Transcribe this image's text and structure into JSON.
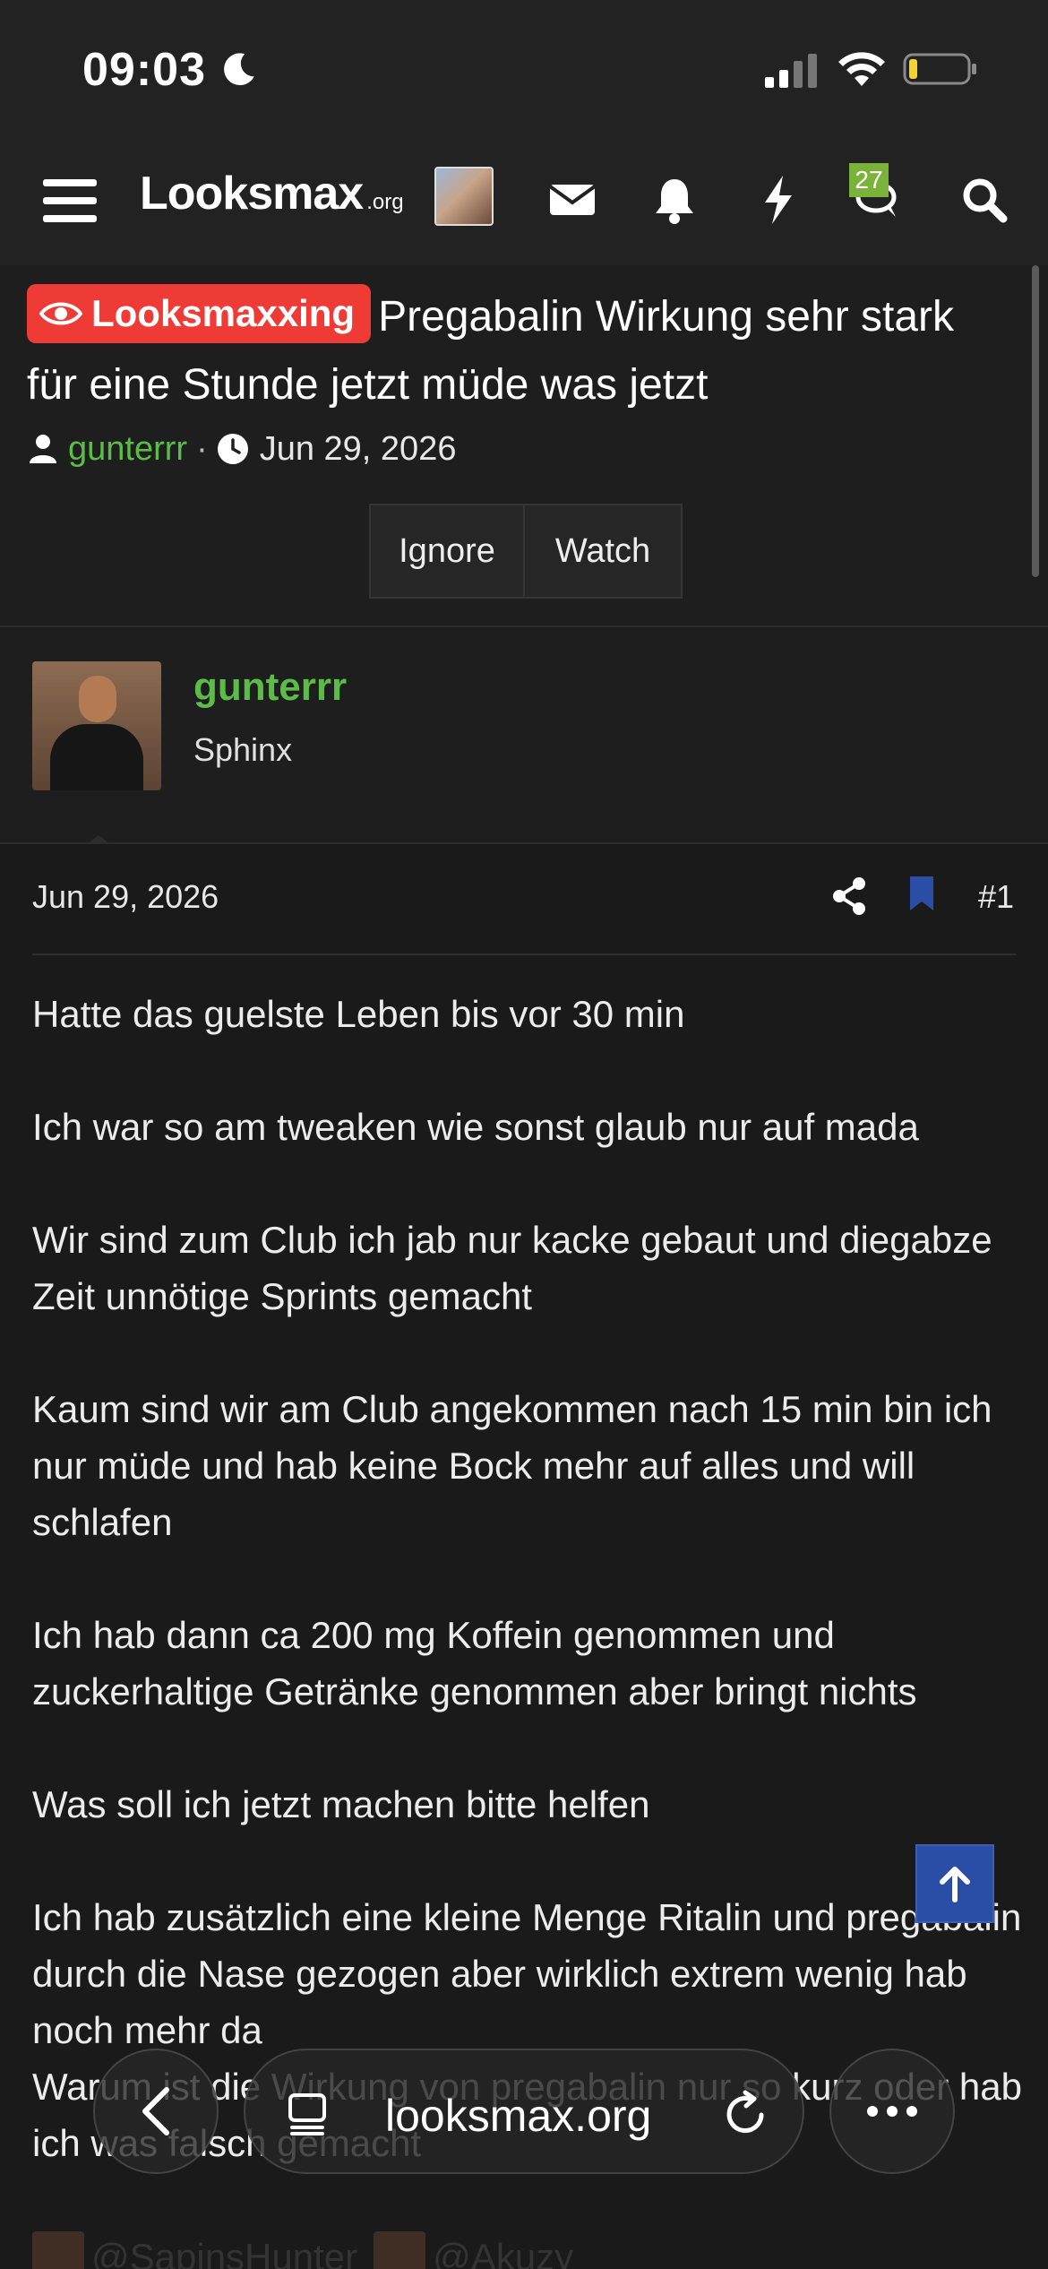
{
  "status_bar": {
    "time": "09:03"
  },
  "nav": {
    "logo_main": "Looksmax",
    "logo_suffix": ".org",
    "conversations_badge": "27"
  },
  "thread": {
    "prefix": "Looksmaxxing",
    "title": "Pregabalin Wirkung sehr stark für eine Stunde jetzt müde was jetzt",
    "author": "gunterrr",
    "date": "Jun 29, 2026",
    "ignore_label": "Ignore",
    "watch_label": "Watch"
  },
  "author_box": {
    "name": "gunterrr",
    "user_title": "Sphinx"
  },
  "post": {
    "date": "Jun 29, 2026",
    "number": "#1",
    "paragraphs": [
      "Hatte das guelste Leben bis vor 30 min",
      "Ich war so am tweaken wie sonst glaub nur auf mada",
      "Wir sind zum Club ich jab nur kacke gebaut und diegabze Zeit unnötige Sprints gemacht",
      "Kaum sind wir am Club angekommen nach 15 min bin ich nur müde und hab keine Bock mehr auf alles und will schlafen",
      "Ich hab dann ca 200 mg Koffein genommen und zuckerhaltige Getränke genommen aber bringt nichts",
      "Was soll ich jetzt machen bitte helfen",
      "Ich hab zusätzlich eine kleine Menge Ritalin und pregabalin durch die Nase gezogen aber wirklich extrem wenig hab noch mehr da",
      "Warum ist die Wirkung von pregabalin nur so kurz oder hab ich was falsch gemacht"
    ],
    "mentions": [
      "@SapinsHunter",
      "@Akuzy"
    ]
  },
  "browser": {
    "url": "looksmax.org"
  },
  "colors": {
    "accent_green": "#5bbd48",
    "prefix_red": "#ee3b35",
    "top_button_blue": "#2a4ea6",
    "bookmark_blue": "#2a4ea6"
  }
}
